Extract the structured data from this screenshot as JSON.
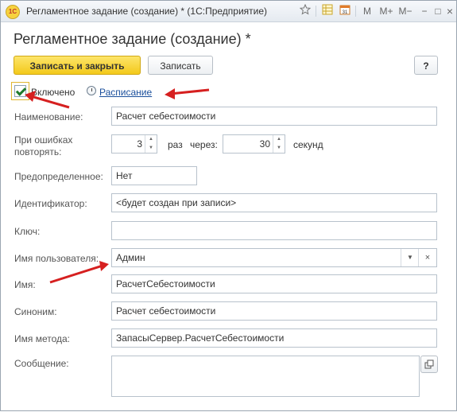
{
  "window": {
    "title": "Регламентное задание (создание) * (1С:Предприятие)",
    "app_icon_text": "1C",
    "toolbar": {
      "m": "M",
      "m_plus": "M+",
      "m_minus": "M−",
      "minimize": "−",
      "maximize": "□",
      "close": "×"
    }
  },
  "form": {
    "title": "Регламентное задание (создание) *",
    "buttons": {
      "save_close": "Записать и закрыть",
      "save": "Записать",
      "help": "?"
    },
    "enabled": {
      "label": "Включено",
      "checked": true
    },
    "schedule_link": "Расписание",
    "fields": {
      "name": {
        "label": "Наименование:",
        "value": "Расчет себестоимости"
      },
      "retry": {
        "label_line1": "При ошибках",
        "label_line2": "повторять:",
        "count": "3",
        "times_label": "раз",
        "through_label": "через:",
        "interval": "30",
        "seconds_label": "секунд"
      },
      "predefined": {
        "label": "Предопределенное:",
        "value": "Нет"
      },
      "identifier": {
        "label": "Идентификатор:",
        "value": "<будет создан при записи>"
      },
      "key": {
        "label": "Ключ:",
        "value": ""
      },
      "user": {
        "label": "Имя пользователя:",
        "value": "Админ"
      },
      "imya": {
        "label": "Имя:",
        "value": "РасчетСебестоимости"
      },
      "synonym": {
        "label": "Синоним:",
        "value": "Расчет себестоимости"
      },
      "method": {
        "label": "Имя метода:",
        "value": "ЗапасыСервер.РасчетСебестоимости"
      },
      "message": {
        "label": "Сообщение:",
        "value": ""
      }
    }
  },
  "colors": {
    "annotation_arrow": "#d62020",
    "primary_button": "#f3c91b",
    "link": "#1a4f9c"
  }
}
